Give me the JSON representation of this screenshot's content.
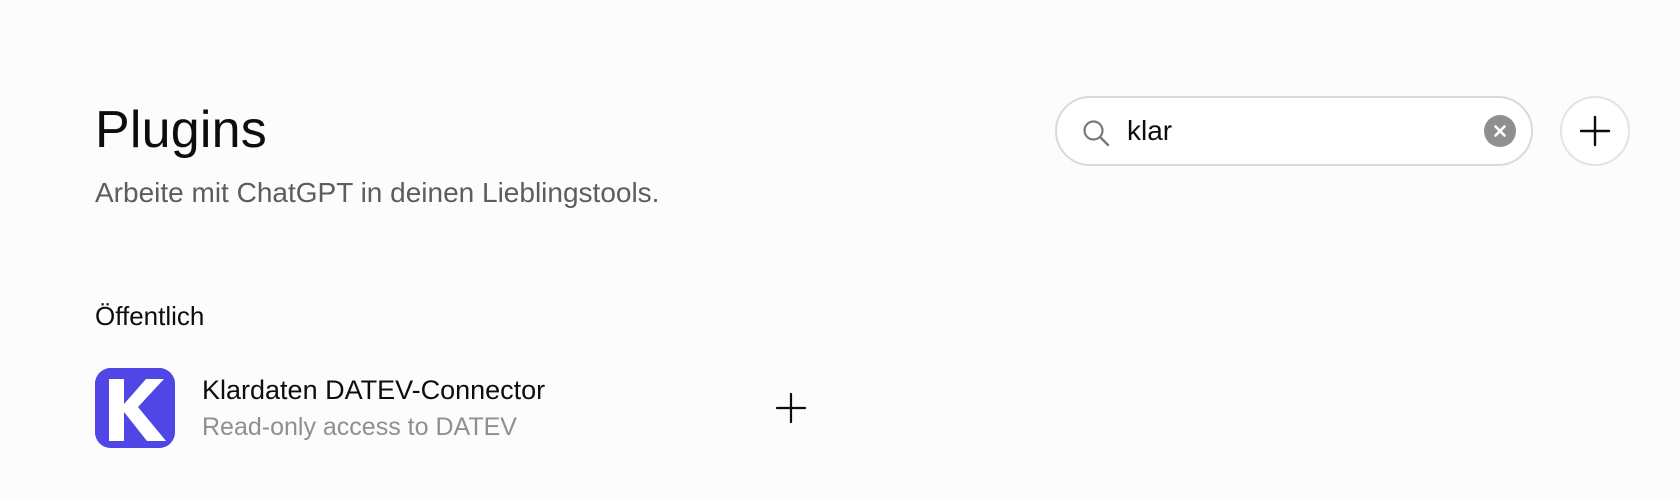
{
  "header": {
    "title": "Plugins",
    "subtitle": "Arbeite mit ChatGPT in deinen Lieblingstools."
  },
  "search": {
    "value": "klar",
    "placeholder": ""
  },
  "icons": {
    "search": "search-icon",
    "clear": "close-icon",
    "add": "plus-icon"
  },
  "sections": [
    {
      "heading": "Öffentlich",
      "plugins": [
        {
          "name": "Klardaten DATEV-Connector",
          "description": "Read-only access to DATEV",
          "logo_letter": "K",
          "logo_color": "#5046e5"
        }
      ]
    }
  ],
  "colors": {
    "background": "#fcfcfc",
    "text_primary": "#0d0d0d",
    "text_secondary": "#5d5d5d",
    "text_muted": "#8f8f8f",
    "accent_logo": "#5046e5"
  }
}
